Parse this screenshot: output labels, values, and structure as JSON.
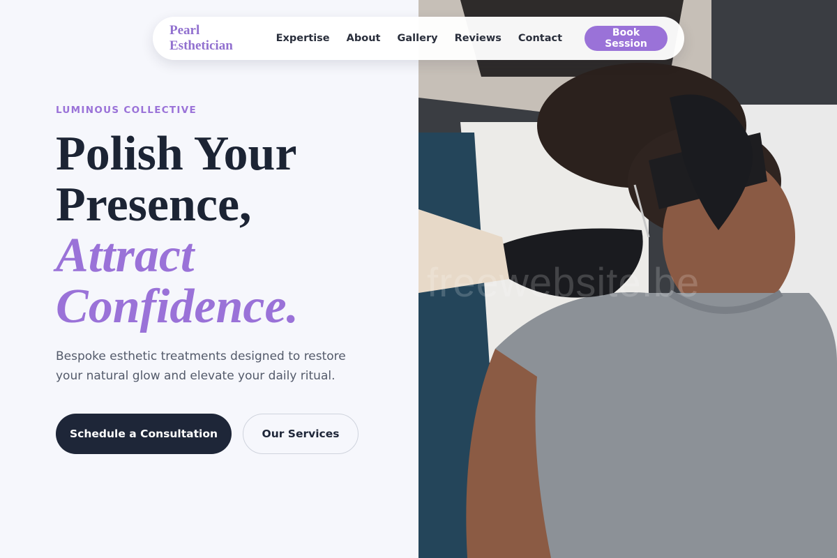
{
  "nav": {
    "brand": "Pearl Esthetician",
    "links": [
      "Expertise",
      "About",
      "Gallery",
      "Reviews",
      "Contact"
    ],
    "cta": "Book Session"
  },
  "hero": {
    "eyebrow": "LUMINOUS COLLECTIVE",
    "headline_line1": "Polish Your",
    "headline_line2": "Presence,",
    "headline_accent1": "Attract",
    "headline_accent2": "Confidence.",
    "subtext": "Bespoke esthetic treatments designed to restore your natural glow and elevate your daily ritual.",
    "primary_button": "Schedule a Consultation",
    "secondary_button": "Our Services"
  },
  "image": {
    "watermark": "freewebsite.be"
  },
  "colors": {
    "accent": "#9a72d8",
    "dark": "#1e2638",
    "background": "#f6f7fc"
  }
}
